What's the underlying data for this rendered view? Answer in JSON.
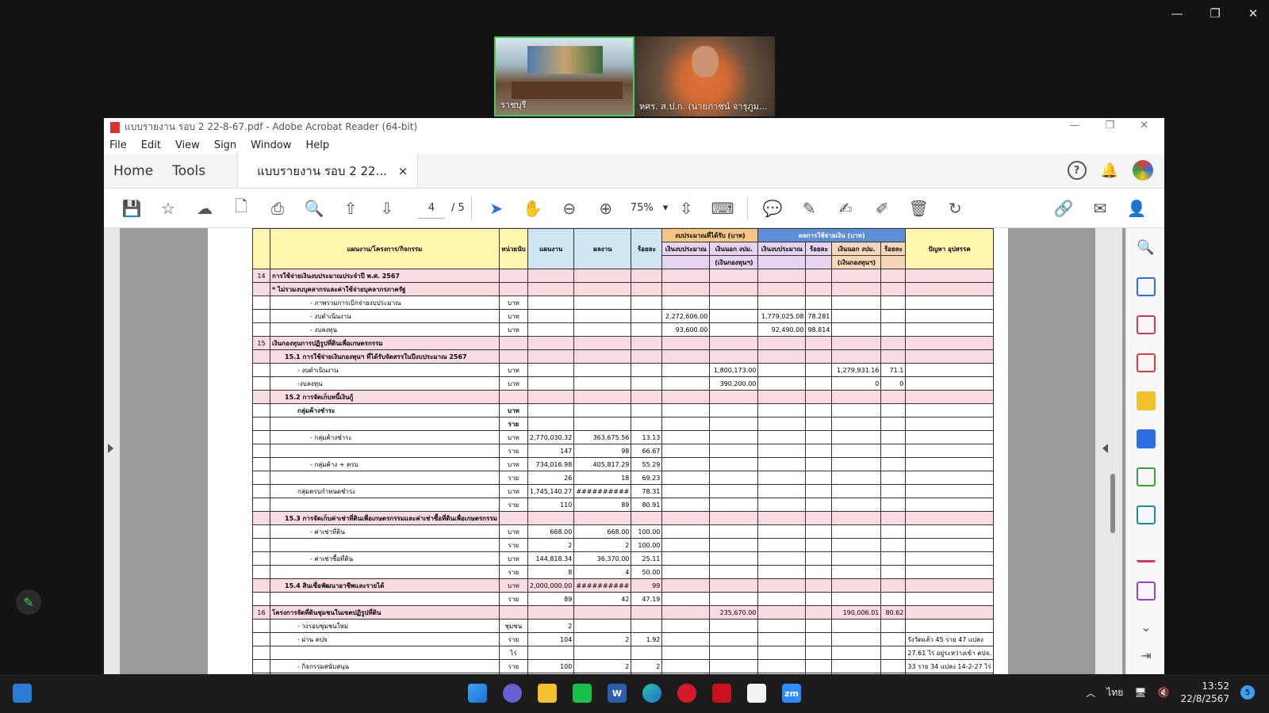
{
  "video": {
    "tiles": [
      {
        "name": "ราชบุรี"
      },
      {
        "name": "หศร. ส.ป.ก. (นายภาชน์ จารุภูม..."
      }
    ]
  },
  "acrobat": {
    "title": "แบบรายงาน รอบ 2 22-8-67.pdf - Adobe Acrobat Reader (64-bit)",
    "menu": [
      "File",
      "Edit",
      "View",
      "Sign",
      "Window",
      "Help"
    ],
    "tabs": {
      "home": "Home",
      "tools": "Tools",
      "doc": "แบบรายงาน รอบ 2 22...",
      "close": "×"
    },
    "toolbar": {
      "page": "4",
      "of": "/ 5",
      "zoom": "75%"
    }
  },
  "table": {
    "header": {
      "plan": "แผนงาน/โครงการ/กิจกรรม",
      "unit": "หน่วยนับ",
      "target": "แผนงาน",
      "result": "ผลงาน",
      "percent": "ร้อยละ",
      "budget_received": "งบประมาณที่ได้รับ (บาท)",
      "budget_spent": "ผลการใช้จ่ายเงิน (บาท)",
      "in_budget": "เงินงบประมาณ",
      "out_budget": "เงินนอก งปม.",
      "fund": "(เงินกองทุนฯ)",
      "in_budget2": "เงินงบประมาณ",
      "pct2": "ร้อยละ",
      "out_budget2": "เงินนอก งปม.",
      "fund2": "(เงินกองทุนฯ)",
      "pct3": "ร้อยละ",
      "problems": "ปัญหา อุปสรรค"
    },
    "rows": [
      {
        "no": "14",
        "label": "การใช้จ่ายเงินงบประมาณประจำปี พ.ศ. 2567",
        "pink": true
      },
      {
        "label": "* ไม่รวมงบบุคลากรและค่าใช้จ่ายบุคลากรภาครัฐ",
        "pink": true,
        "indent": 0
      },
      {
        "label": "- ภาพรวมการเบิกจ่ายงบประมาณ",
        "unit": "บาท",
        "indent": 3
      },
      {
        "label": "- งบดำเนินงาน",
        "unit": "บาท",
        "indent": 3,
        "in_budget": "2,272,606.00",
        "spent_in": "1,779,025.08",
        "pct2": "78.281"
      },
      {
        "label": "- งบลงทุน",
        "unit": "บาท",
        "indent": 3,
        "in_budget": "93,600.00",
        "spent_in": "92,490.00",
        "pct2": "98.814"
      },
      {
        "no": "15",
        "label": "เงินกองทุนการปฏิรูปที่ดินเพื่อเกษตรกรรม",
        "pink": true
      },
      {
        "label": "15.1 การใช้จ่ายเงินกองทุนฯ ที่ได้รับจัดสรรในปีงบประมาณ 2567",
        "pink": true,
        "indent": 1
      },
      {
        "label": "- งบดำเนินงาน",
        "unit": "บาท",
        "indent": 2,
        "out_budget": "1,800,173.00",
        "spent_out": "1,279,931.16",
        "pct3": "71.1"
      },
      {
        "label": "-งบลงทุน",
        "unit": "บาท",
        "indent": 2,
        "out_budget": "390,200.00",
        "spent_out": "0",
        "pct3": "0"
      },
      {
        "label": "15.2 การจัดเก็บหนี้เงินกู้",
        "pink": true,
        "indent": 1
      },
      {
        "label": "กลุ่มค้างชำระ",
        "unit": "บาท",
        "indent": 2,
        "bold": true
      },
      {
        "label": "",
        "unit": "ราย",
        "bold": true
      },
      {
        "label": "- กลุ่มค้างชำระ",
        "unit": "บาท",
        "indent": 3,
        "target": "2,770,030.32",
        "result": "363,675.56",
        "percent": "13.13"
      },
      {
        "label": "",
        "unit": "ราย",
        "target": "147",
        "result": "98",
        "percent": "66.67"
      },
      {
        "label": "- กลุ่มค้าง + ครบ",
        "unit": "บาท",
        "indent": 3,
        "target": "734,016.98",
        "result": "405,817.29",
        "percent": "55.29"
      },
      {
        "label": "",
        "unit": "ราย",
        "target": "26",
        "result": "18",
        "percent": "69.23"
      },
      {
        "label": "กลุ่มครบกำหนดชำระ",
        "unit": "บาท",
        "indent": 2,
        "target": "1,745,140.27",
        "result": "##########",
        "percent": "78.31"
      },
      {
        "label": "",
        "unit": "ราย",
        "target": "110",
        "result": "89",
        "percent": "80.91"
      },
      {
        "label": "15.3 การจัดเก็บค่าเช่าที่ดินเพื่อเกษตรกรรมและค่าเช่าซื้อที่ดินเพื่อเกษตรกรรม",
        "pink": true,
        "indent": 1
      },
      {
        "label": "- ค่าเช่าที่ดิน",
        "unit": "บาท",
        "indent": 3,
        "target": "668.00",
        "result": "668.00",
        "percent": "100.00"
      },
      {
        "label": "",
        "unit": "ราย",
        "target": "2",
        "result": "2",
        "percent": "100.00"
      },
      {
        "label": "- ค่าเช่าซื้อที่ดิน",
        "unit": "บาท",
        "indent": 3,
        "target": "144,818.34",
        "result": "36,370.00",
        "percent": "25.11"
      },
      {
        "label": "",
        "unit": "ราย",
        "target": "8",
        "result": "4",
        "percent": "50.00"
      },
      {
        "label": "15.4 สินเชื่อพัฒนาอาชีพและรายได้",
        "unit": "บาท",
        "pink": true,
        "indent": 1,
        "target": "2,000,000.00",
        "result": "##########",
        "percent": "99"
      },
      {
        "label": "",
        "unit": "ราย",
        "target": "89",
        "result": "42",
        "percent": "47.19"
      },
      {
        "no": "16",
        "label": "โครงการจัดที่ดินชุมชนในเขตปฏิรูปที่ดิน",
        "pink": true,
        "out_budget": "235,670.00",
        "spent_out": "190,006.01",
        "pct3": "80.62"
      },
      {
        "label": "- วงรอบชุมชนใหม่",
        "unit": "ชุมชน",
        "indent": 2,
        "target": "2"
      },
      {
        "label": "- ผ่าน คปจ",
        "unit": "ราย",
        "indent": 2,
        "target": "104",
        "result": "2",
        "percent": "1.92",
        "problem": "รังวัดแล้ว 45 ราย 47 แปลง"
      },
      {
        "label": "",
        "unit": "ไร่",
        "problem": "27.61 ไร่ อยู่ระหว่างเข้า คปจ."
      },
      {
        "label": "- กิจกรรมสนับสนุน",
        "unit": "ราย",
        "indent": 2,
        "target": "100",
        "result": "2",
        "percent": "2",
        "problem": "33 ราย 34 แปลง 14-2-27 ไร่"
      },
      {
        "label": "",
        "unit": "ไร่"
      }
    ]
  },
  "taskbar": {
    "lang": "ไทย",
    "time": "13:52",
    "date": "22/8/2567",
    "badge": "5"
  },
  "colors": {
    "pink_row": "#f9dbe2",
    "budget_header": "#f6c784",
    "spent_header": "#5e8fd6",
    "blue_cols": "#cde6f2",
    "purple_cols": "#e6d3ef",
    "yellow_col": "#fff6b0",
    "peach_col": "#f6d7b8",
    "green_active": "#3fcf5a"
  }
}
